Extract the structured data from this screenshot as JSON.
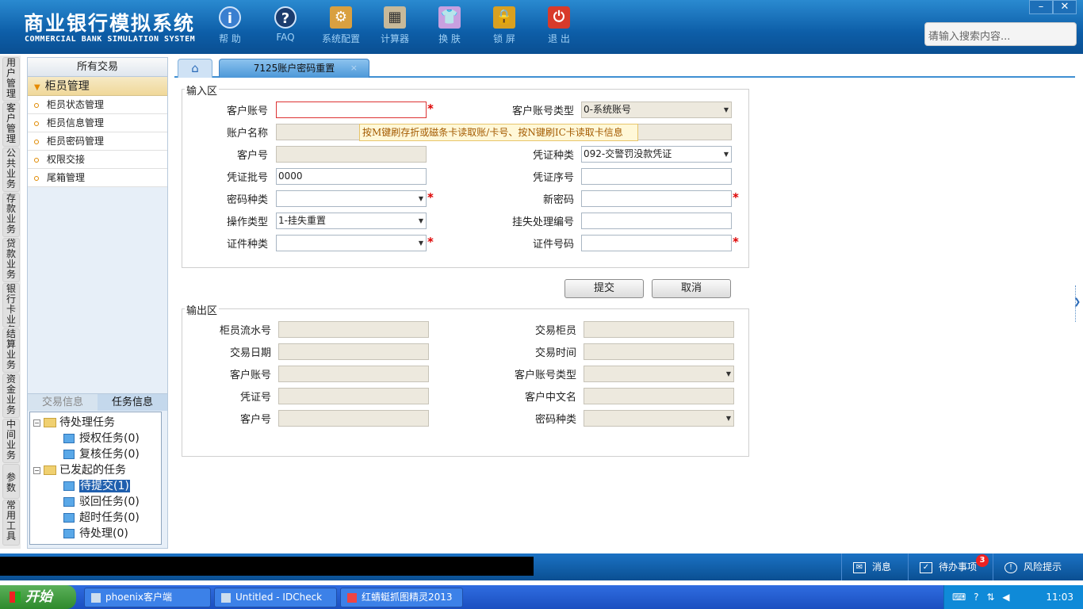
{
  "header": {
    "title_cn": "商业银行模拟系统",
    "title_en": "COMMERCIAL BANK SIMULATION SYSTEM",
    "buttons": [
      {
        "label": "帮 助",
        "icon": "help-icon",
        "glyph": "i"
      },
      {
        "label": "FAQ",
        "icon": "faq-icon",
        "glyph": "?"
      },
      {
        "label": "系统配置",
        "icon": "system-config-icon",
        "glyph": "⚙"
      },
      {
        "label": "计算器",
        "icon": "calculator-icon",
        "glyph": "▦"
      },
      {
        "label": "换 肤",
        "icon": "skin-icon",
        "glyph": "👕"
      },
      {
        "label": "锁 屏",
        "icon": "lock-icon",
        "glyph": "🔒"
      },
      {
        "label": "退 出",
        "icon": "exit-icon",
        "glyph": "⏻"
      }
    ],
    "search_placeholder": "请输入搜索内容...",
    "win_min": "–",
    "win_close": "✕"
  },
  "vmenu": [
    "用户管理",
    "客户管理",
    "公共业务",
    "存款业务",
    "贷款业务",
    "银行卡业务",
    "结算业务",
    "资金业务",
    "中间业务",
    "参数",
    "常用工具"
  ],
  "left": {
    "title": "所有交易",
    "group": "柜员管理",
    "items": [
      "柜员状态管理",
      "柜员信息管理",
      "柜员密码管理",
      "权限交接",
      "尾箱管理"
    ],
    "tab_trade": "交易信息",
    "tab_task": "任务信息",
    "tree": {
      "pending": "待处理任务",
      "auth": "授权任务(0)",
      "review": "复核任务(0)",
      "initiated": "已发起的任务",
      "to_submit": "待提交(1)",
      "rejected": "驳回任务(0)",
      "timeout": "超时任务(0)",
      "to_process": "待处理(0)"
    }
  },
  "tabs": {
    "current": "7125账户密码重置",
    "close": "×"
  },
  "input": {
    "title": "输入区",
    "customer_account": {
      "label": "客户账号",
      "value": ""
    },
    "account_type": {
      "label": "客户账号类型",
      "value": "0-系统账号"
    },
    "account_name": {
      "label": "账户名称",
      "value": ""
    },
    "customer_no": {
      "label": "客户号",
      "value": ""
    },
    "voucher_type": {
      "label": "凭证种类",
      "value": "092-交警罚没款凭证"
    },
    "voucher_batch": {
      "label": "凭证批号",
      "value": "0000"
    },
    "voucher_seq": {
      "label": "凭证序号",
      "value": ""
    },
    "pwd_type": {
      "label": "密码种类",
      "value": ""
    },
    "new_pwd": {
      "label": "新密码",
      "value": ""
    },
    "op_type": {
      "label": "操作类型",
      "value": "1-挂失重置"
    },
    "loss_no": {
      "label": "挂失处理编号",
      "value": ""
    },
    "id_type": {
      "label": "证件种类",
      "value": ""
    },
    "id_no": {
      "label": "证件号码",
      "value": ""
    },
    "required_mark": "*",
    "tooltip": "按M键刷存折或磁条卡读取账/卡号、按N键刷IC卡读取卡信息"
  },
  "actions": {
    "submit": "提交",
    "cancel": "取消"
  },
  "output": {
    "title": "输出区",
    "teller_seq": "柜员流水号",
    "trade_teller": "交易柜员",
    "trade_date": "交易日期",
    "trade_time": "交易时间",
    "customer_account": "客户账号",
    "account_type": "客户账号类型",
    "voucher_no": "凭证号",
    "customer_cn_name": "客户中文名",
    "customer_no": "客户号",
    "pwd_type": "密码种类"
  },
  "statusbar": {
    "messages": "消息",
    "todo": "待办事项",
    "todo_count": "3",
    "risk": "风险提示"
  },
  "taskbar": {
    "start": "开始",
    "apps": [
      "phoenix客户端",
      "Untitled - IDCheck",
      "红蜻蜓抓图精灵2013"
    ],
    "clock": "11:03"
  },
  "colors": {
    "header": "#0d5ea8",
    "accent": "#3f8fd2",
    "required": "#dd0000"
  }
}
